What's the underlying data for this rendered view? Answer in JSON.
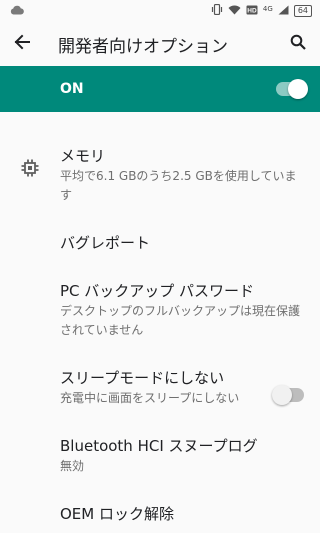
{
  "status_bar": {
    "network_label": "4G",
    "battery": "64",
    "icons": [
      "cloud-icon",
      "vibrate-icon",
      "wifi-icon",
      "hd-icon",
      "signal-icon",
      "battery-icon"
    ]
  },
  "app_bar": {
    "title": "開発者向けオプション",
    "back_icon": "arrow-back-icon",
    "search_icon": "search-icon"
  },
  "master_switch": {
    "label": "ON",
    "enabled": true,
    "color": "#00897b"
  },
  "settings": [
    {
      "title": "メモリ",
      "summary": "平均で6.1 GBのうち2.5 GBを使用しています",
      "icon": "memory-chip-icon"
    },
    {
      "title": "バグレポート"
    },
    {
      "title": "PC バックアップ パスワード",
      "summary": "デスクトップのフルバックアップは現在保護されていません"
    },
    {
      "title": "スリープモードにしない",
      "summary": "充電中に画面をスリープにしない",
      "toggle": false
    },
    {
      "title": "Bluetooth HCI スヌープログ",
      "summary": "無効"
    },
    {
      "title": "OEM ロック解除"
    }
  ]
}
